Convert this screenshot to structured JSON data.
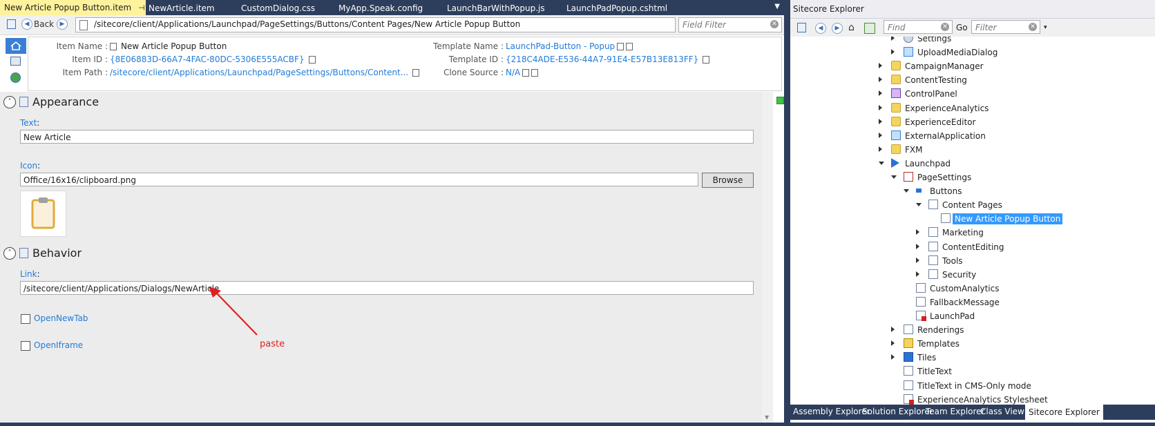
{
  "tabs": [
    {
      "label": "New Article Popup Button.item",
      "active": true
    },
    {
      "label": "NewArticle.item"
    },
    {
      "label": "CustomDialog.css"
    },
    {
      "label": "MyApp.Speak.config"
    },
    {
      "label": "LaunchBarWithPopup.js"
    },
    {
      "label": "LaunchPadPopup.cshtml"
    }
  ],
  "nav": {
    "back_label": "Back",
    "path": "/sitecore/client/Applications/Launchpad/PageSettings/Buttons/Content Pages/New Article Popup Button",
    "field_filter_placeholder": "Field Filter"
  },
  "info": {
    "item_name_label": "Item Name :",
    "item_name": "New Article Popup Button",
    "item_id_label": "Item ID :",
    "item_id": "{8E06883D-66A7-4FAC-80DC-5306E555ACBF}",
    "item_path_label": "Item Path :",
    "item_path": "/sitecore/client/Applications/Launchpad/PageSettings/Buttons/Content...",
    "template_name_label": "Template Name :",
    "template_name": "LaunchPad-Button - Popup",
    "template_id_label": "Template ID :",
    "template_id": "{218C4ADE-E536-44A7-91E4-E57B13E813FF}",
    "clone_source_label": "Clone Source :",
    "clone_source": "N/A"
  },
  "sections": {
    "appearance": "Appearance",
    "behavior": "Behavior"
  },
  "fields": {
    "text_label": "Text",
    "text_value": "New Article",
    "icon_label": "Icon",
    "icon_value": "Office/16x16/clipboard.png",
    "browse_label": "Browse",
    "link_label": "Link",
    "link_value": "/sitecore/client/Applications/Dialogs/NewArticle",
    "open_new_tab_label": "OpenNewTab",
    "open_iframe_label": "OpenIframe",
    "colon": ":"
  },
  "annotation": {
    "text": "paste",
    "color": "#e02020"
  },
  "explorer": {
    "title": "Sitecore Explorer",
    "find_placeholder": "Find",
    "go_label": "Go",
    "filter_placeholder": "Filter",
    "tree": [
      {
        "label": "Settings",
        "depth": 1,
        "arrow": "right",
        "icon": "gear"
      },
      {
        "label": "UploadMediaDialog",
        "depth": 1,
        "arrow": "right",
        "icon": "app"
      },
      {
        "label": "CampaignManager",
        "depth": 0,
        "arrow": "right",
        "icon": "folder"
      },
      {
        "label": "ContentTesting",
        "depth": 0,
        "arrow": "right",
        "icon": "folder"
      },
      {
        "label": "ControlPanel",
        "depth": 0,
        "arrow": "right",
        "icon": "cp"
      },
      {
        "label": "ExperienceAnalytics",
        "depth": 0,
        "arrow": "right",
        "icon": "folder"
      },
      {
        "label": "ExperienceEditor",
        "depth": 0,
        "arrow": "right",
        "icon": "folder"
      },
      {
        "label": "ExternalApplication",
        "depth": 0,
        "arrow": "right",
        "icon": "app"
      },
      {
        "label": "FXM",
        "depth": 0,
        "arrow": "right",
        "icon": "folder"
      },
      {
        "label": "Launchpad",
        "depth": 0,
        "arrow": "down",
        "icon": "play"
      },
      {
        "label": "PageSettings",
        "depth": 1,
        "arrow": "down",
        "icon": "check"
      },
      {
        "label": "Buttons",
        "depth": 2,
        "arrow": "down",
        "icon": "bar"
      },
      {
        "label": "Content Pages",
        "depth": 3,
        "arrow": "down",
        "icon": "doc"
      },
      {
        "label": "New Article Popup Button",
        "depth": 4,
        "arrow": "",
        "icon": "doc",
        "selected": true
      },
      {
        "label": "Marketing",
        "depth": 3,
        "arrow": "right",
        "icon": "doc"
      },
      {
        "label": "ContentEditing",
        "depth": 3,
        "arrow": "right",
        "icon": "doc"
      },
      {
        "label": "Tools",
        "depth": 3,
        "arrow": "right",
        "icon": "doc"
      },
      {
        "label": "Security",
        "depth": 3,
        "arrow": "right",
        "icon": "doc"
      },
      {
        "label": "CustomAnalytics",
        "depth": 2,
        "arrow": "",
        "icon": "doc"
      },
      {
        "label": "FallbackMessage",
        "depth": 2,
        "arrow": "",
        "icon": "doc"
      },
      {
        "label": "LaunchPad",
        "depth": 2,
        "arrow": "",
        "icon": "docred"
      },
      {
        "label": "Renderings",
        "depth": 1,
        "arrow": "right",
        "icon": "doc"
      },
      {
        "label": "Templates",
        "depth": 1,
        "arrow": "right",
        "icon": "tmpl"
      },
      {
        "label": "Tiles",
        "depth": 1,
        "arrow": "right",
        "icon": "tiles"
      },
      {
        "label": "TitleText",
        "depth": 1,
        "arrow": "",
        "icon": "doc"
      },
      {
        "label": "TitleText in CMS-Only mode",
        "depth": 1,
        "arrow": "",
        "icon": "doc"
      },
      {
        "label": "ExperienceAnalytics Stylesheet",
        "depth": 1,
        "arrow": "",
        "icon": "docred"
      }
    ]
  },
  "bottom_tabs": [
    {
      "label": "Assembly Explorer"
    },
    {
      "label": "Solution Explorer"
    },
    {
      "label": "Team Explorer"
    },
    {
      "label": "Class View"
    },
    {
      "label": "Sitecore Explorer",
      "active": true
    }
  ]
}
